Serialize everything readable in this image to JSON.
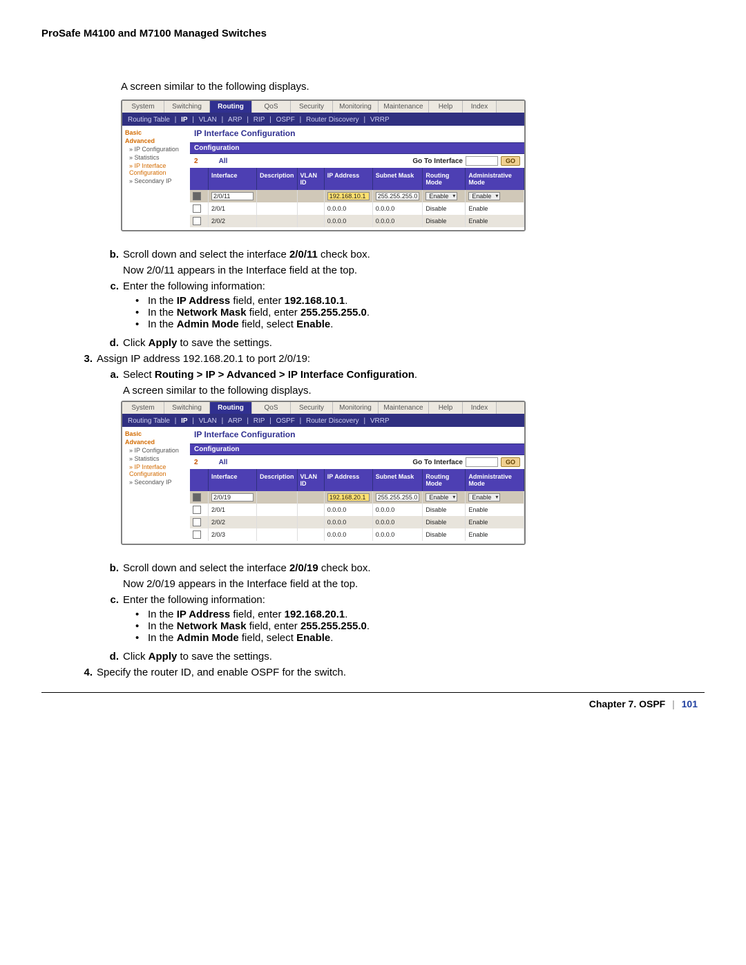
{
  "header": "ProSafe M4100 and M7100 Managed Switches",
  "intro1": "A screen similar to the following displays.",
  "intro2": "A screen similar to the following displays.",
  "tabs": [
    "System",
    "Switching",
    "Routing",
    "QoS",
    "Security",
    "Monitoring",
    "Maintenance",
    "Help",
    "Index"
  ],
  "tab_widths": [
    60,
    65,
    60,
    55,
    60,
    65,
    72,
    48,
    48
  ],
  "tabs_active_index": 2,
  "subnav": [
    "Routing Table",
    "IP",
    "VLAN",
    "ARP",
    "RIP",
    "OSPF",
    "Router Discovery",
    "VRRP"
  ],
  "subnav_active_index": 1,
  "leftnav": {
    "basic": "Basic",
    "advanced": "Advanced",
    "ipconf": "» IP Configuration",
    "stats": "» Statistics",
    "ipiface": "» IP Interface Configuration",
    "secip": "» Secondary IP"
  },
  "panel_title": "IP Interface Configuration",
  "conf_label": "Configuration",
  "filter": {
    "n": "2",
    "all": "All",
    "goto": "Go To Interface",
    "go": "GO"
  },
  "cols": [
    "",
    "Interface",
    "Description",
    "VLAN ID",
    "IP Address",
    "Subnet Mask",
    "Routing Mode",
    "Administrative Mode"
  ],
  "shot1": {
    "selrow": {
      "iface": "2/0/11",
      "ip": "192.168.10.1",
      "mask": "255.255.255.0",
      "rmode": "Enable",
      "amode": "Enable"
    },
    "rows": [
      {
        "iface": "2/0/1",
        "ip": "0.0.0.0",
        "mask": "0.0.0.0",
        "rmode": "Disable",
        "amode": "Enable",
        "alt": false
      },
      {
        "iface": "2/0/2",
        "ip": "0.0.0.0",
        "mask": "0.0.0.0",
        "rmode": "Disable",
        "amode": "Enable",
        "alt": true
      }
    ]
  },
  "shot2": {
    "selrow": {
      "iface": "2/0/19",
      "ip": "192.168.20.1",
      "mask": "255.255.255.0",
      "rmode": "Enable",
      "amode": "Enable"
    },
    "rows": [
      {
        "iface": "2/0/1",
        "ip": "0.0.0.0",
        "mask": "0.0.0.0",
        "rmode": "Disable",
        "amode": "Enable",
        "alt": false
      },
      {
        "iface": "2/0/2",
        "ip": "0.0.0.0",
        "mask": "0.0.0.0",
        "rmode": "Disable",
        "amode": "Enable",
        "alt": true
      },
      {
        "iface": "2/0/3",
        "ip": "0.0.0.0",
        "mask": "0.0.0.0",
        "rmode": "Disable",
        "amode": "Enable",
        "alt": false
      }
    ]
  },
  "steps1": {
    "b1": "Scroll down and select the interface ",
    "b1b": "2/0/11",
    "b1suf": " check box.",
    "b2": "Now 2/0/11 appears in the Interface field at the top.",
    "c1": "Enter the following information:",
    "c_ip_pre": "In the ",
    "c_ip_b": "IP Address",
    "c_ip_mid": " field, enter ",
    "c_ip_val": "192.168.10.1",
    "c_ip_end": ".",
    "c_nm_pre": "In the ",
    "c_nm_b": "Network Mask",
    "c_nm_mid": " field, enter ",
    "c_nm_val": "255.255.255.0",
    "c_nm_end": ".",
    "c_am_pre": "In the ",
    "c_am_b": "Admin Mode",
    "c_am_mid": " field, select ",
    "c_am_val": "Enable",
    "c_am_end": ".",
    "d_pre": "Click ",
    "d_b": "Apply",
    "d_suf": " to save the settings."
  },
  "step3": {
    "num": "3.",
    "text": "Assign IP address 192.168.20.1 to port 2/0/19:",
    "a_pre": "Select ",
    "a_b": "Routing > IP > Advanced > IP Interface Configuration",
    "a_end": "."
  },
  "steps2": {
    "b1": "Scroll down and select the interface ",
    "b1b": "2/0/19",
    "b1suf": " check box.",
    "b2": "Now 2/0/19 appears in the Interface field at the top.",
    "c1": "Enter the following information:",
    "c_ip_pre": "In the ",
    "c_ip_b": "IP Address",
    "c_ip_mid": " field, enter ",
    "c_ip_val": "192.168.20.1",
    "c_ip_end": ".",
    "c_nm_pre": "In the ",
    "c_nm_b": "Network Mask",
    "c_nm_mid": " field, enter ",
    "c_nm_val": "255.255.255.0",
    "c_nm_end": ".",
    "c_am_pre": "In the ",
    "c_am_b": "Admin Mode",
    "c_am_mid": " field, select ",
    "c_am_val": "Enable",
    "c_am_end": ".",
    "d_pre": "Click ",
    "d_b": "Apply",
    "d_suf": " to save the settings."
  },
  "step4": {
    "num": "4.",
    "text": "Specify the router ID, and enable OSPF for the switch."
  },
  "labels": {
    "b": "b.",
    "c": "c.",
    "d": "d.",
    "a": "a."
  },
  "footer": {
    "chapter": "Chapter 7.  OSPF",
    "bar": "|",
    "page": "101"
  }
}
